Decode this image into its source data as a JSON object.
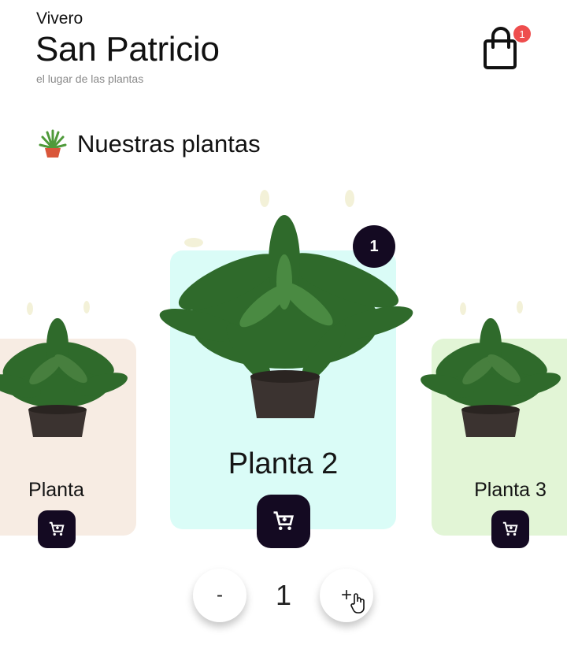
{
  "header": {
    "eyebrow": "Vivero",
    "title": "San Patricio",
    "tagline": "el lugar de las plantas",
    "cart_badge": "1",
    "cart_icon": "shopping-bag-icon"
  },
  "section": {
    "emoji_icon": "potted-plant-icon",
    "title": "Nuestras plantas"
  },
  "cards": [
    {
      "label": "Planta",
      "color": "#f7ece3"
    },
    {
      "label": "Planta 2",
      "color": "#dafcf7",
      "quantity_badge": "1"
    },
    {
      "label": "Planta 3",
      "color": "#e2f5d6"
    }
  ],
  "stepper": {
    "minus_label": "-",
    "value": "1",
    "plus_label": "+"
  },
  "colors": {
    "accent_dark": "#140a22",
    "badge_red": "#ee4d4d"
  }
}
